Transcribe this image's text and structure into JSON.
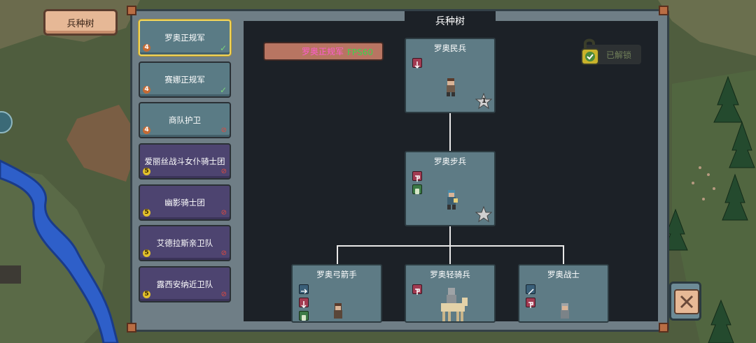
{
  "header": {
    "tree_tab_label": "兵种树",
    "panel_title": "兵种树"
  },
  "sidebar": {
    "items": [
      {
        "label": "罗奥正规军",
        "level": "4",
        "status": "unlocked",
        "selected": true,
        "color": "teal"
      },
      {
        "label": "赛娜正规军",
        "level": "4",
        "status": "unlocked",
        "selected": false,
        "color": "teal"
      },
      {
        "label": "商队护卫",
        "level": "4",
        "status": "locked",
        "selected": false,
        "color": "teal"
      },
      {
        "label": "爱丽丝战斗女仆骑士团",
        "level": "5",
        "status": "locked",
        "selected": false,
        "color": "purple"
      },
      {
        "label": "幽影骑士团",
        "level": "5",
        "status": "locked",
        "selected": false,
        "color": "purple"
      },
      {
        "label": "艾德拉斯亲卫队",
        "level": "5",
        "status": "locked",
        "selected": false,
        "color": "purple"
      },
      {
        "label": "露西安纳近卫队",
        "level": "5",
        "status": "locked",
        "selected": false,
        "color": "purple"
      }
    ]
  },
  "main": {
    "faction_tag": "罗奥正规军",
    "fps_label": "FPS60",
    "unlock_label": "已解锁",
    "units": {
      "militia": {
        "name": "罗奥民兵",
        "tier": "1"
      },
      "infantry": {
        "name": "罗奥步兵"
      },
      "archer": {
        "name": "罗奥弓箭手"
      },
      "light_cavalry": {
        "name": "罗奥轻骑兵"
      },
      "warrior": {
        "name": "罗奥战士"
      }
    }
  },
  "colors": {
    "accent_gold": "#f1d45a",
    "panel_teal": "#5e7b85",
    "panel_purple": "#4d4470",
    "fps_green": "#3fd24d",
    "faction_pink": "#ff5bd1"
  }
}
